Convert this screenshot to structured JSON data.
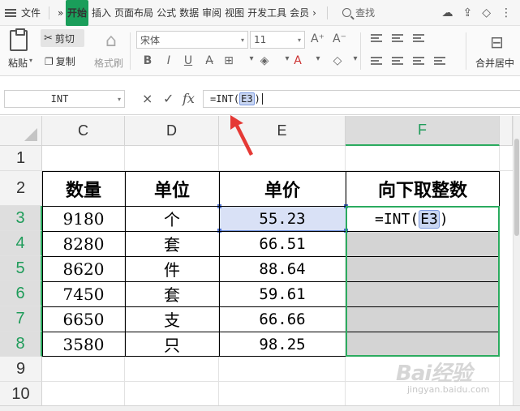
{
  "menubar": {
    "file": "文件",
    "more_left": "»",
    "tabs": [
      "开始",
      "插入",
      "页面布局",
      "公式",
      "数据",
      "审阅",
      "视图",
      "开发工具",
      "会员"
    ],
    "more_right": "›",
    "search": "查找"
  },
  "ribbon": {
    "cut": "剪切",
    "paste": "粘贴",
    "copy": "复制",
    "format_painter": "格式刷",
    "font_name": "宋体",
    "font_size": "11",
    "merge": "合并居中"
  },
  "formula_bar": {
    "name_box": "INT",
    "cancel": "×",
    "confirm": "✓",
    "fx": "fx",
    "formula_prefix": "=INT(",
    "formula_ref": "E3",
    "formula_suffix": ")"
  },
  "sheet": {
    "columns": [
      "C",
      "D",
      "E",
      "F"
    ],
    "rows": [
      "1",
      "2",
      "3",
      "4",
      "5",
      "6",
      "7",
      "8",
      "9",
      "10"
    ],
    "headers": [
      "数量",
      "单位",
      "单价",
      "向下取整数"
    ],
    "data": [
      [
        "9180",
        "个",
        "55.23"
      ],
      [
        "8280",
        "套",
        "66.51"
      ],
      [
        "8620",
        "件",
        "88.64"
      ],
      [
        "7450",
        "套",
        "59.61"
      ],
      [
        "6650",
        "支",
        "66.66"
      ],
      [
        "3580",
        "只",
        "98.25"
      ]
    ],
    "f3_formula_prefix": "=INT(",
    "f3_formula_ref": "E3",
    "f3_formula_suffix": ")"
  },
  "watermark": {
    "main": "Bai经验",
    "sub": "jingyan.baidu.com"
  },
  "colors": {
    "accent_green": "#2bab5f",
    "ref_highlight": "#c9d6f2",
    "selection_blue": "#6f8fd9",
    "fill_gray": "#d4d4d4",
    "annotation_red": "#e53935"
  }
}
